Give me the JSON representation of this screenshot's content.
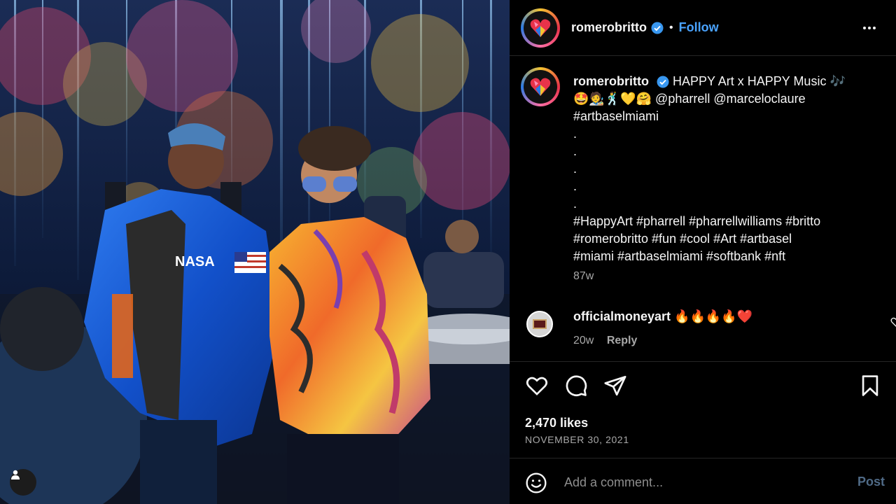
{
  "post": {
    "username": "romerobritto",
    "follow_label": "Follow",
    "separator": "•",
    "caption_lines": [
      "HAPPY Art x HAPPY Music 🎶",
      "🤩🧑‍🎨🕺💛🤗 @pharrell @marceloclaure",
      "#artbaselmiami",
      ".",
      ".",
      ".",
      ".",
      ".",
      "#HappyArt #pharrell #pharrellwilliams #britto",
      "#romerobritto #fun #cool #Art #artbasel",
      "#miami #artbaselmiami #softbank #nft"
    ],
    "caption_time": "87w",
    "likes": "2,470 likes",
    "date": "NOVEMBER 30, 2021"
  },
  "comment": {
    "username": "officialmoneyart",
    "text": "🔥🔥🔥🔥❤️",
    "time": "20w",
    "reply_label": "Reply"
  },
  "add_comment": {
    "placeholder": "Add a comment...",
    "post_label": "Post"
  },
  "colors": {
    "background": "#000000",
    "accent_link": "#4aa3ff",
    "muted_text": "#a8a8a8",
    "post_button_disabled": "#4f6a86"
  },
  "icons": {
    "header_more": "more-horizontal-icon",
    "verified": "verified-badge-icon",
    "like": "heart-icon",
    "comment": "comment-bubble-icon",
    "share": "paper-plane-icon",
    "save": "bookmark-icon",
    "emoji": "smiley-icon",
    "tagged_users": "user-tag-icon"
  }
}
